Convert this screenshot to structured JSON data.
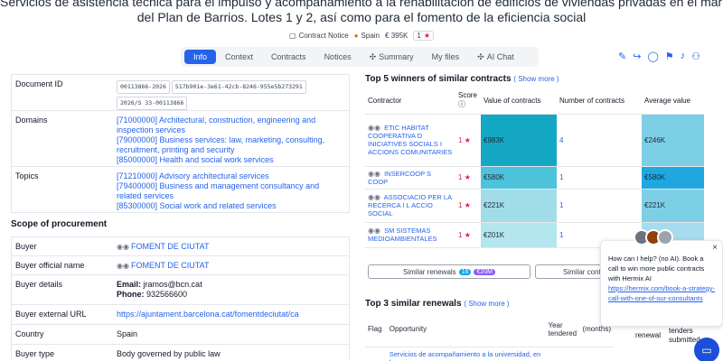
{
  "page": {
    "title_line1": "Servicios de asistencia técnica para el impulso y acompañamiento a la rehabilitación de edificios de viviendas privadas en el marco",
    "title_line2": "del Plan de Barrios. Lotes 1 y 2, así como para el fomento de la eficiencia social"
  },
  "meta": {
    "notice": "Contract Notice",
    "country": "Spain",
    "value": "€ 395K",
    "score": "1"
  },
  "tabs": [
    "Info",
    "Context",
    "Contracts",
    "Notices",
    "Summary",
    "My files",
    "AI Chat"
  ],
  "info": {
    "document_id": {
      "label": "Document ID",
      "codes": [
        "00113866-2026",
        "517b901e-3e61-42cb-8246-955e5b273291",
        "2026/S 33-00113866"
      ]
    },
    "domains": {
      "label": "Domains",
      "items": [
        "[71000000] Architectural, construction, engineering and inspection services",
        "[79000000] Business services: law, marketing, consulting, recruitment, printing and security",
        "[85000000] Health and social work services"
      ]
    },
    "topics": {
      "label": "Topics",
      "items": [
        "[71210000] Advisory architectural services",
        "[79400000] Business and management consultancy and related services",
        "[85300000] Social work and related services"
      ]
    }
  },
  "scope": {
    "title": "Scope of procurement",
    "buyer_label": "Buyer",
    "buyer": "FOMENT DE CIUTAT",
    "official_label": "Buyer official name",
    "official": "FOMENT DE CIUTAT",
    "details_label": "Buyer details",
    "email_label": "Email:",
    "email": "jramos@bcn.cat",
    "phone_label": "Phone:",
    "phone": "932566600",
    "url_label": "Buyer external URL",
    "url": "https://ajuntament.barcelona.cat/fomentdeciutat/ca",
    "country_label": "Country",
    "country": "Spain",
    "type_label": "Buyer type",
    "type": "Body governed by public law"
  },
  "winners": {
    "title": "Top 5 winners of similar contracts",
    "more": "( Show more )",
    "headers": [
      "Contractor",
      "Score",
      "Value of contracts",
      "Number of contracts",
      "Average value"
    ],
    "rows": [
      {
        "name": "ETIC HABITAT COOPERATIVA D INICIATIVES SOCIALS I ACCIONS COMUNITARIES",
        "score": "1",
        "value": "€983K",
        "count": "4",
        "avg": "€246K",
        "vc": "#14a8c4",
        "ac": "#7dcfe6"
      },
      {
        "name": "INSERCOOP S COOP",
        "score": "1",
        "value": "€580K",
        "count": "1",
        "avg": "€580K",
        "vc": "#4cc3da",
        "ac": "#21a7e0"
      },
      {
        "name": "ASSOCIACIO PER LA RECERCA I L ACCIO SOCIAL",
        "score": "1",
        "value": "€221K",
        "count": "1",
        "avg": "€221K",
        "vc": "#a0dde9",
        "ac": "#7dcfe6"
      },
      {
        "name": "SM SISTEMAS MEDIOAMBIENTALES",
        "score": "1",
        "value": "€201K",
        "count": "1",
        "avg": "€201K",
        "vc": "#b4e6ef",
        "ac": "#a6dcee"
      }
    ]
  },
  "similar": {
    "label": "Similar renewals",
    "count": "16",
    "amount": "€20M",
    "label2": "Similar cont"
  },
  "renewals": {
    "title": "Top 3 similar renewals",
    "more": "( Show more )",
    "headers": [
      "Flag",
      "Opportunity",
      "Year tendered",
      "(months)",
      "renewal",
      "tenders submitted"
    ],
    "first": "Servicios de acompañamiento a la universidad, en los"
  },
  "chat": {
    "text": "How can I help? (no AI). Book a call to win more public contracts with Hermix AI",
    "link": "https://hermix.com/book-a-strategy-call-with-one-of-our-consultants"
  },
  "colors": {
    "accent": "#2563eb",
    "star": "#e11d48"
  }
}
